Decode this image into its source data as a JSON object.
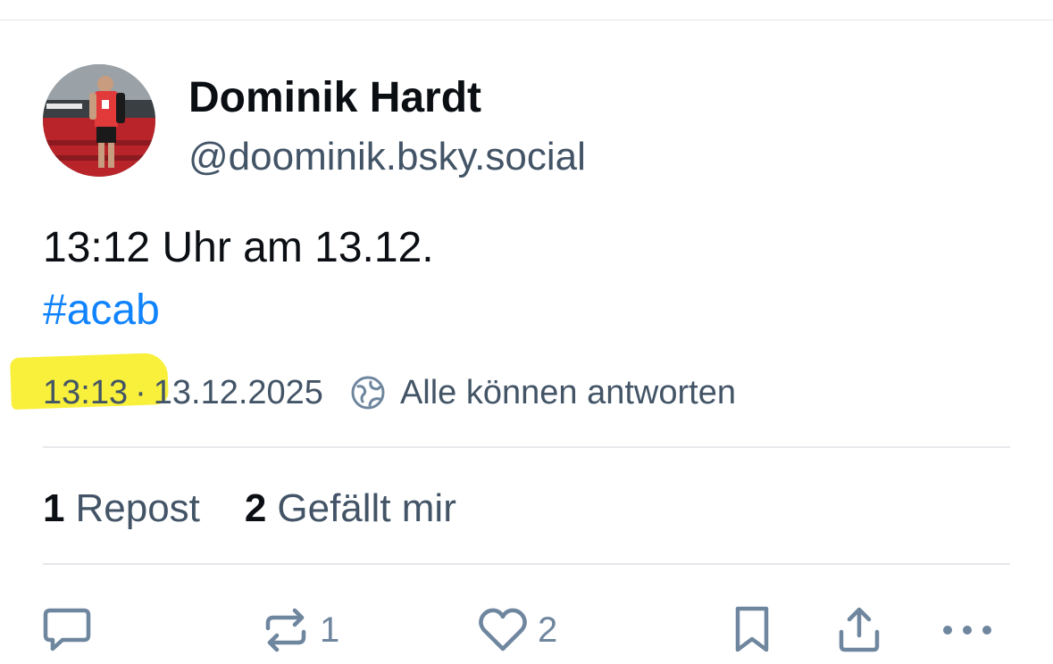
{
  "author": {
    "display_name": "Dominik Hardt",
    "handle": "@doominik.bsky.social"
  },
  "post": {
    "text": "13:12 Uhr am 13.12.",
    "hashtag": "#acab"
  },
  "meta": {
    "time": "13:13",
    "separator": "·",
    "date": "13.12.2025",
    "reply_setting": "Alle können antworten",
    "reply_icon": "globe-icon"
  },
  "stats": {
    "reposts_count": "1",
    "reposts_label": "Repost",
    "likes_count": "2",
    "likes_label": "Gefällt mir"
  },
  "actions": {
    "reply_icon": "comment-icon",
    "repost_icon": "repost-icon",
    "repost_count": "1",
    "like_icon": "heart-icon",
    "like_count": "2",
    "bookmark_icon": "bookmark-icon",
    "share_icon": "share-icon",
    "more_icon": "more-icon"
  },
  "colors": {
    "text_primary": "#0b0f14",
    "text_secondary": "#425466",
    "link": "#1083fe",
    "icon": "#6f869f",
    "divider": "#e6e8eb",
    "highlight": "#f7ef2a"
  }
}
